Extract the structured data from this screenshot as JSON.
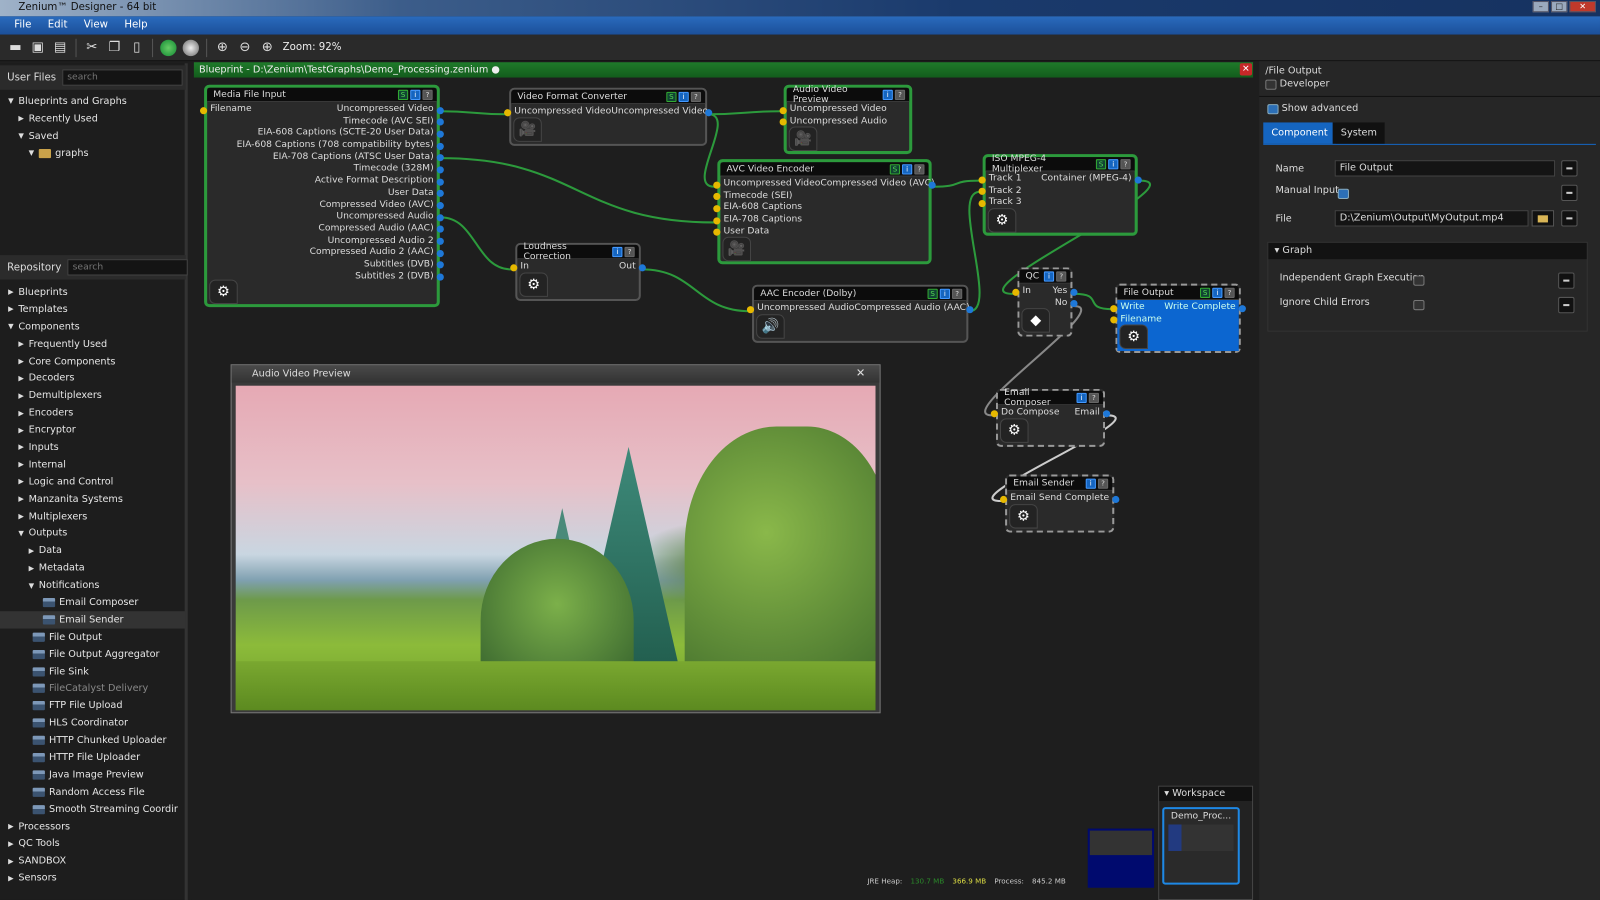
{
  "window": {
    "title": "Zenium™ Designer - 64 bit",
    "min": "–",
    "max": "□",
    "close": "✕"
  },
  "menu": [
    "File",
    "Edit",
    "View",
    "Help"
  ],
  "toolbar": {
    "zoom_label": "Zoom:  92%",
    "icons": [
      "open-icon",
      "save-icon",
      "save-as-icon",
      "cut-icon",
      "copy-icon",
      "paste-icon",
      "run-icon",
      "stop-icon",
      "zoom-in-icon",
      "zoom-out-icon",
      "zoom-reset-icon"
    ]
  },
  "user_files": {
    "label": "User Files",
    "placeholder": "search",
    "tree": [
      {
        "label": "Blueprints and Graphs",
        "level": 0,
        "state": "open"
      },
      {
        "label": "Recently Used",
        "level": 1,
        "state": "closed"
      },
      {
        "label": "Saved",
        "level": 1,
        "state": "open"
      },
      {
        "label": "graphs",
        "level": 2,
        "state": "open",
        "folder": true
      }
    ]
  },
  "repository": {
    "label": "Repository",
    "placeholder": "search",
    "tree": [
      {
        "label": "Blueprints",
        "level": 0,
        "state": "closed"
      },
      {
        "label": "Templates",
        "level": 0,
        "state": "closed"
      },
      {
        "label": "Components",
        "level": 0,
        "state": "open"
      },
      {
        "label": "Frequently Used",
        "level": 1,
        "state": "closed"
      },
      {
        "label": "Core Components",
        "level": 1,
        "state": "closed"
      },
      {
        "label": "Decoders",
        "level": 1,
        "state": "closed"
      },
      {
        "label": "Demultiplexers",
        "level": 1,
        "state": "closed"
      },
      {
        "label": "Encoders",
        "level": 1,
        "state": "closed"
      },
      {
        "label": "Encryptor",
        "level": 1,
        "state": "closed"
      },
      {
        "label": "Inputs",
        "level": 1,
        "state": "closed"
      },
      {
        "label": "Internal",
        "level": 1,
        "state": "closed"
      },
      {
        "label": "Logic and Control",
        "level": 1,
        "state": "closed"
      },
      {
        "label": "Manzanita Systems",
        "level": 1,
        "state": "closed"
      },
      {
        "label": "Multiplexers",
        "level": 1,
        "state": "closed"
      },
      {
        "label": "Outputs",
        "level": 1,
        "state": "open"
      },
      {
        "label": "Data",
        "level": 2,
        "state": "closed"
      },
      {
        "label": "Metadata",
        "level": 2,
        "state": "closed"
      },
      {
        "label": "Notifications",
        "level": 2,
        "state": "open"
      },
      {
        "label": "Email Composer",
        "level": 3,
        "state": "leaf"
      },
      {
        "label": "Email Sender",
        "level": 3,
        "state": "leaf",
        "selected": true
      },
      {
        "label": "File Output",
        "level": 2,
        "state": "leaf"
      },
      {
        "label": "File Output Aggregator",
        "level": 2,
        "state": "leaf"
      },
      {
        "label": "File Sink",
        "level": 2,
        "state": "leaf"
      },
      {
        "label": "FileCatalyst Delivery",
        "level": 2,
        "state": "leaf",
        "disabled": true
      },
      {
        "label": "FTP File Upload",
        "level": 2,
        "state": "leaf"
      },
      {
        "label": "HLS Coordinator",
        "level": 2,
        "state": "leaf"
      },
      {
        "label": "HTTP Chunked Uploader",
        "level": 2,
        "state": "leaf"
      },
      {
        "label": "HTTP File Uploader",
        "level": 2,
        "state": "leaf"
      },
      {
        "label": "Java Image Preview",
        "level": 2,
        "state": "leaf"
      },
      {
        "label": "Random Access File",
        "level": 2,
        "state": "leaf"
      },
      {
        "label": "Smooth Streaming Coordir",
        "level": 2,
        "state": "leaf"
      },
      {
        "label": "Processors",
        "level": 0,
        "state": "closed"
      },
      {
        "label": "QC Tools",
        "level": 0,
        "state": "closed"
      },
      {
        "label": "SANDBOX",
        "level": 0,
        "state": "closed"
      },
      {
        "label": "Sensors",
        "level": 0,
        "state": "closed"
      }
    ]
  },
  "blueprint": {
    "title": "Blueprint - D:\\Zenium\\TestGraphs\\Demo_Processing.zenium ●",
    "close": "✕",
    "nodes": [
      {
        "id": "mfi",
        "title": "Media File Input",
        "style": "green",
        "badges": [
          "S",
          "i",
          "?"
        ],
        "icon": "gear-icon",
        "inputs": [
          "Filename"
        ],
        "outputs": [
          "Uncompressed Video",
          "Timecode (AVC SEI)",
          "EIA-608 Captions (SCTE-20 User Data)",
          "EIA-608 Captions (708 compatibility bytes)",
          "EIA-708 Captions (ATSC User Data)",
          "Timecode (328M)",
          "Active Format Description",
          "User Data",
          "Compressed Video (AVC)",
          "Uncompressed Audio",
          "Compressed Audio (AAC)",
          "Uncompressed Audio 2",
          "Compressed Audio 2 (AAC)",
          "Subtitles (DVB)",
          "Subtitles 2 (DVB)"
        ]
      },
      {
        "id": "vfc",
        "title": "Video Format Converter",
        "style": "grey",
        "badges": [
          "S",
          "i",
          "?"
        ],
        "icon": "video-camera-icon",
        "inputs": [
          "Uncompressed Video"
        ],
        "outputs": [
          "Uncompressed Video"
        ]
      },
      {
        "id": "avp",
        "title": "Audio Video Preview",
        "style": "green",
        "badges": [
          "i",
          "?"
        ],
        "icon": "video-camera-icon",
        "inputs": [
          "Uncompressed Video",
          "Uncompressed Audio"
        ],
        "outputs": []
      },
      {
        "id": "avc",
        "title": "AVC Video Encoder",
        "style": "green",
        "badges": [
          "S",
          "i",
          "?"
        ],
        "icon": "video-camera-icon",
        "inputs": [
          "Uncompressed Video",
          "Timecode (SEI)",
          "EIA-608 Captions",
          "EIA-708 Captions",
          "User Data"
        ],
        "outputs": [
          "Compressed Video (AVC)"
        ]
      },
      {
        "id": "mux",
        "title": "ISO MPEG-4 Multiplexer",
        "style": "green",
        "badges": [
          "S",
          "i",
          "?"
        ],
        "icon": "gear-icon",
        "inputs": [
          "Track 1",
          "Track 2",
          "Track 3"
        ],
        "outputs": [
          "Container (MPEG-4)"
        ]
      },
      {
        "id": "loud",
        "title": "Loudness Correction",
        "style": "grey",
        "badges": [
          "i",
          "?"
        ],
        "icon": "gear-icon",
        "inputs": [
          "In"
        ],
        "outputs": [
          "Out"
        ]
      },
      {
        "id": "aac",
        "title": "AAC Encoder (Dolby)",
        "style": "grey",
        "badges": [
          "S",
          "i",
          "?"
        ],
        "icon": "speaker-icon",
        "inputs": [
          "Uncompressed Audio"
        ],
        "outputs": [
          "Compressed Audio (AAC)"
        ]
      },
      {
        "id": "qc",
        "title": "QC",
        "style": "dashed",
        "badges": [
          "i",
          "?"
        ],
        "icon": "decision-icon",
        "inputs": [
          "In"
        ],
        "outputs": [
          "Yes",
          "No"
        ]
      },
      {
        "id": "fo",
        "title": "File Output",
        "style": "dashed blue",
        "badges": [
          "S",
          "i",
          "?"
        ],
        "icon": "gear-icon",
        "inputs": [
          "Write",
          "Filename"
        ],
        "outputs": [
          "Write Complete"
        ]
      },
      {
        "id": "ec",
        "title": "Email Composer",
        "style": "dashed",
        "badges": [
          "i",
          "?"
        ],
        "icon": "gear-icon",
        "inputs": [
          "Do Compose"
        ],
        "outputs": [
          "Email"
        ]
      },
      {
        "id": "es",
        "title": "Email Sender",
        "style": "dashed",
        "badges": [
          "i",
          "?"
        ],
        "icon": "gear-icon",
        "inputs": [
          "Email"
        ],
        "outputs": [
          "Send Complete"
        ]
      }
    ],
    "link_color": "#2c9a3c"
  },
  "preview": {
    "title": "Audio Video Preview",
    "close": "✕"
  },
  "properties": {
    "path": "/File Output",
    "developer": "Developer",
    "developer_checked": false,
    "show_advanced": "Show advanced",
    "show_advanced_checked": true,
    "tabs": [
      "Component",
      "System"
    ],
    "active_tab": "Component",
    "fields": {
      "name_label": "Name",
      "name_value": "File Output",
      "manual_label": "Manual Input",
      "manual_checked": true,
      "file_label": "File",
      "file_value": "D:\\Zenium\\Output\\MyOutput.mp4"
    },
    "graph": {
      "header": "Graph",
      "independent": "Independent Graph Execution",
      "ignore": "Ignore Child Errors"
    }
  },
  "workspace": {
    "header": "Workspace",
    "item": "Demo_Proc..."
  },
  "status": {
    "heap_label": "JRE Heap:",
    "heap_used": "130.7 MB",
    "heap_total": "366.9 MB",
    "process_label": "Process:",
    "process_value": "845.2 MB"
  }
}
